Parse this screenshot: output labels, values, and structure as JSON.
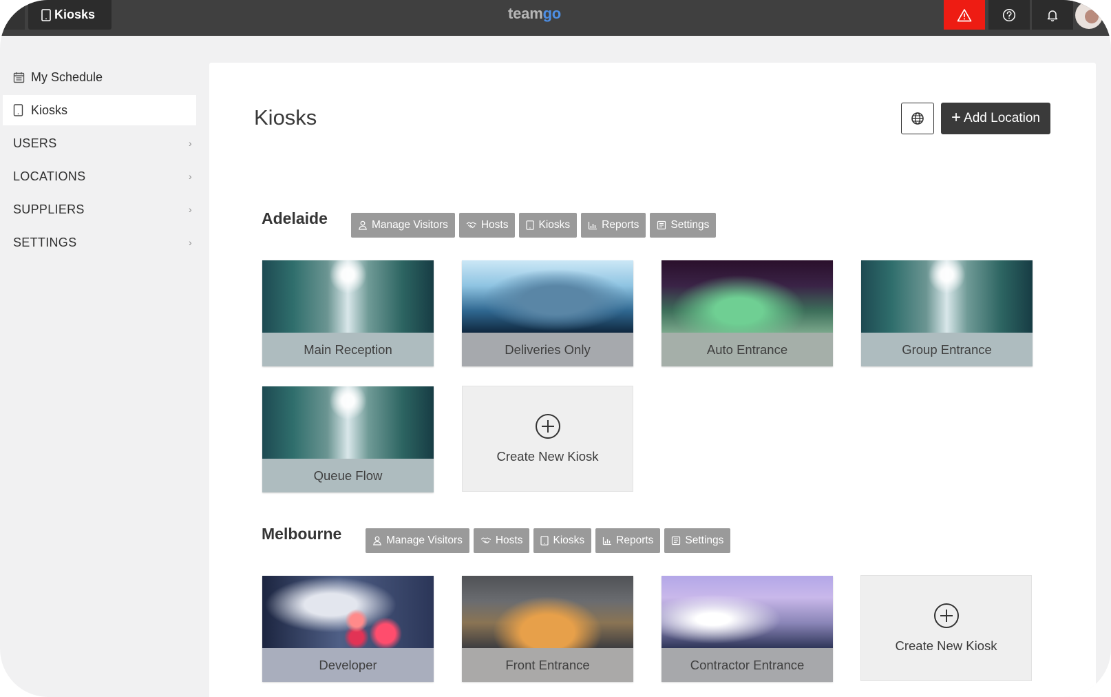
{
  "topbar": {
    "tab_label": "Kiosks",
    "brand_team": "team",
    "brand_go": "go",
    "alert_icon": "warning-icon",
    "help_icon": "help-circle-icon",
    "notification_icon": "bell-icon",
    "alert_color": "#ee1c13"
  },
  "sidebar": {
    "schedule_label": "My Schedule",
    "kiosks_label": "Kiosks",
    "users_label": "USERS",
    "locations_label": "LOCATIONS",
    "suppliers_label": "SUPPLIERS",
    "settings_label": "SETTINGS"
  },
  "main": {
    "title": "Kiosks",
    "add_location_label": "Add Location",
    "add_location_plus": "+"
  },
  "locations": [
    {
      "name": "Adelaide",
      "actions": [
        "Manage Visitors",
        "Hosts",
        "Kiosks",
        "Reports",
        "Settings"
      ],
      "kiosks": [
        "Main Reception",
        "Deliveries Only",
        "Auto Entrance",
        "Group Entrance",
        "Queue Flow"
      ],
      "create_label": "Create New Kiosk"
    },
    {
      "name": "Melbourne",
      "actions": [
        "Manage Visitors",
        "Hosts",
        "Kiosks",
        "Reports",
        "Settings"
      ],
      "kiosks": [
        "Developer",
        "Front Entrance",
        "Contractor Entrance"
      ],
      "create_label": "Create New Kiosk"
    }
  ]
}
